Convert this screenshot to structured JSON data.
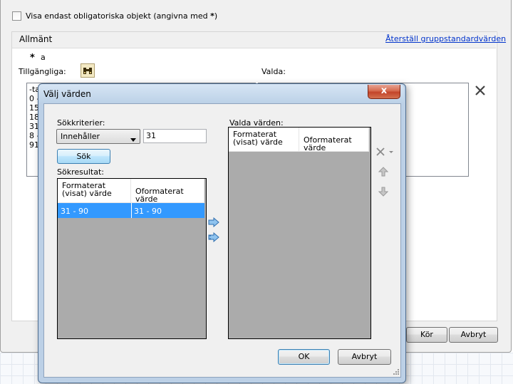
{
  "top": {
    "checkbox_label": "Visa endast obligatoriska objekt (angivna med ",
    "checkbox_label_star": "*",
    "checkbox_label_end": ")"
  },
  "section": {
    "title": "Allmänt",
    "reset_link": "Återställ gruppstandardvärden",
    "required_star": "*",
    "field_name": "a",
    "available_label": "Tillgängliga:",
    "selected_label": "Valda:",
    "available_items": [
      "-ta",
      "0 -",
      "15",
      "18",
      "31",
      "8 -",
      "91"
    ]
  },
  "outer_buttons": {
    "run": "Kör",
    "cancel": "Avbryt"
  },
  "dialog": {
    "title": "Välj värden",
    "close_glyph": "x",
    "search_criteria_label": "Sökkriterier:",
    "search_mode": "Innehåller",
    "search_value": "31",
    "search_button": "Sök",
    "results_label": "Sökresultat:",
    "results_columns": [
      "Formaterat (visat) värde",
      "Oformaterat värde"
    ],
    "results_rows": [
      [
        "31 - 90",
        "31 - 90"
      ]
    ],
    "selected_label": "Valda värden:",
    "selected_columns": [
      "Formaterat (visat) värde",
      "Oformaterat värde"
    ],
    "ok_button": "OK",
    "cancel_button": "Avbryt"
  },
  "colors": {
    "selection": "#3399ff",
    "link": "#0033cc",
    "grid_fill": "#ababab"
  }
}
